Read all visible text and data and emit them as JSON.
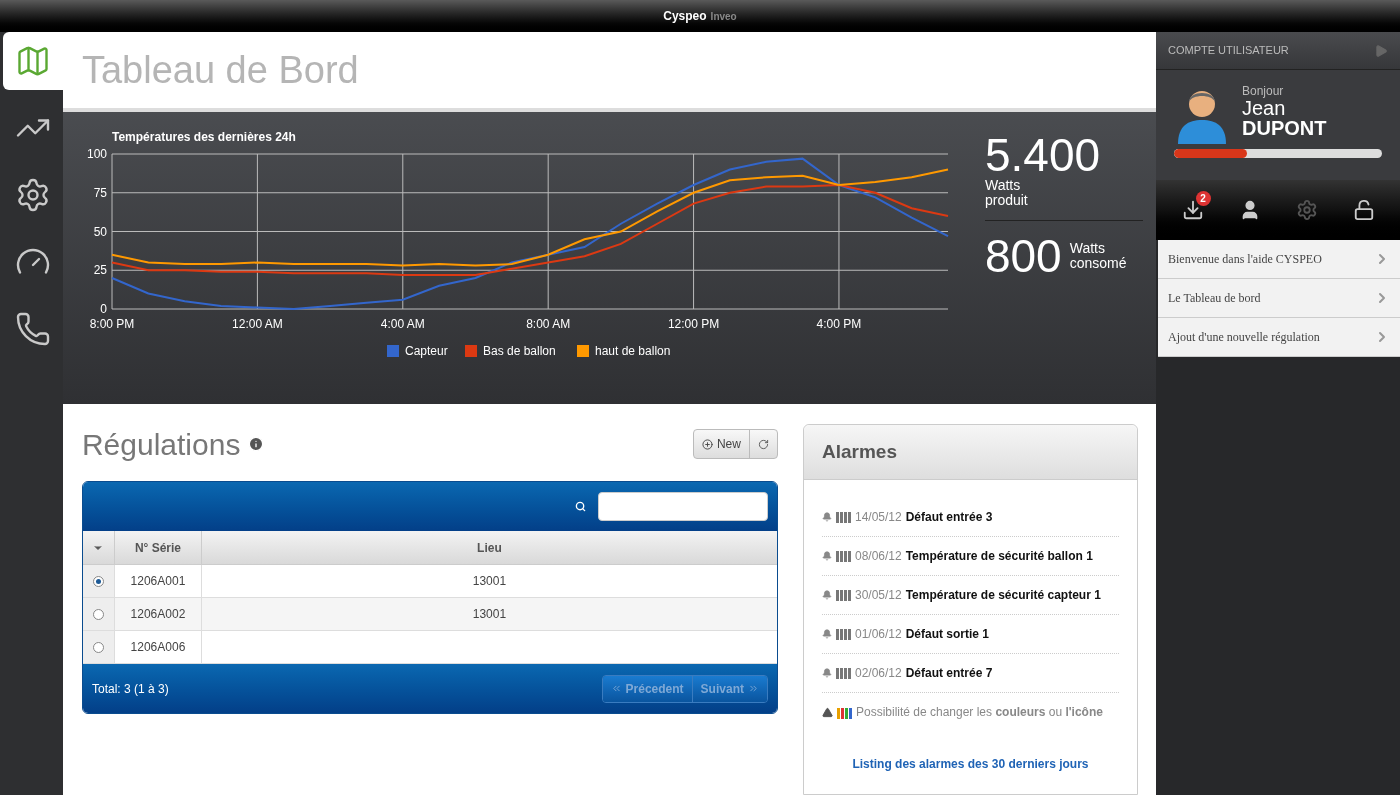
{
  "top_bar": {
    "brand": "Cyspeo",
    "product": "Inveo"
  },
  "sidebar": {
    "items": [
      {
        "selected": true
      },
      {
        "selected": false
      },
      {
        "selected": false
      },
      {
        "selected": false
      },
      {
        "selected": false
      }
    ]
  },
  "page_title": "Tableau de Bord",
  "chart_data": {
    "type": "line",
    "title": "Températures des dernières 24h",
    "categories": [
      "8:00 PM",
      null,
      null,
      null,
      "12:00 AM",
      null,
      null,
      null,
      "4:00 AM",
      null,
      null,
      null,
      "8:00 AM",
      null,
      null,
      null,
      "12:00 PM",
      null,
      null,
      null,
      "4:00 PM",
      null,
      null,
      null
    ],
    "ylim": [
      0,
      100
    ],
    "yticks": [
      0,
      25,
      50,
      75,
      100
    ],
    "grid": true,
    "legend": "bottom",
    "series": [
      {
        "name": "Capteur",
        "color": "#3366cc",
        "values": [
          20,
          10,
          5,
          2,
          1,
          0,
          2,
          4,
          6,
          15,
          20,
          30,
          35,
          40,
          55,
          68,
          80,
          90,
          95,
          97,
          80,
          72,
          59,
          47
        ]
      },
      {
        "name": "Bas de ballon",
        "color": "#dc3912",
        "values": [
          30,
          25,
          25,
          24,
          24,
          23,
          23,
          23,
          22,
          22,
          22,
          26,
          30,
          34,
          42,
          55,
          68,
          75,
          79,
          79,
          80,
          75,
          65,
          60
        ]
      },
      {
        "name": "haut de ballon",
        "color": "#ff9900",
        "values": [
          35,
          30,
          29,
          29,
          30,
          29,
          29,
          29,
          28,
          29,
          28,
          29,
          35,
          45,
          50,
          63,
          75,
          83,
          85,
          86,
          80,
          82,
          85,
          90
        ]
      }
    ]
  },
  "stats": [
    {
      "kind": "stacked",
      "value": "5.400",
      "unit": "Watts produit"
    },
    {
      "kind": "inline",
      "value": "800",
      "unit": "Watts consomé"
    }
  ],
  "regulations": {
    "title": "Régulations",
    "new_button": "New",
    "columns": [
      "N° Série",
      "Lieu"
    ],
    "rows": [
      {
        "serial": "1206A001",
        "place": "13001",
        "selected": true
      },
      {
        "serial": "1206A002",
        "place": "13001",
        "selected": false
      },
      {
        "serial": "1206A006",
        "selected": false
      }
    ],
    "total": "Total: 3 (1 à 3)",
    "pager": [
      {
        "label": "Précedent",
        "kind": "prev",
        "disabled": true
      },
      {
        "label": "Suivant",
        "kind": "next",
        "disabled": true
      }
    ]
  },
  "alarms": {
    "title": "Alarmes",
    "items": [
      {
        "date": "14/05/12",
        "label": "Défaut entrée 3"
      },
      {
        "date": "08/06/12",
        "label": "Température de sécurité ballon 1"
      },
      {
        "date": "30/05/12",
        "label": "Température de sécurité capteur 1"
      },
      {
        "date": "01/06/12",
        "label": "Défaut sortie 1"
      },
      {
        "date": "02/06/12",
        "label": "Défaut entrée 7"
      }
    ],
    "note": "Possibilité de changer les **couleurs** ou **l'icône**",
    "link": "Listing des alarmes des 30 derniers jours"
  },
  "account": {
    "header": "COMPTE UTILISATEUR",
    "greeting": "Bonjour",
    "first_name": "Jean",
    "last_name": "DUPONT",
    "level": 0.35,
    "inbox_badge": "2",
    "help_items": [
      "Bienvenue dans l'aide CYSPEO",
      "Le Tableau de bord",
      "Ajout d'une nouvelle régulation"
    ]
  }
}
